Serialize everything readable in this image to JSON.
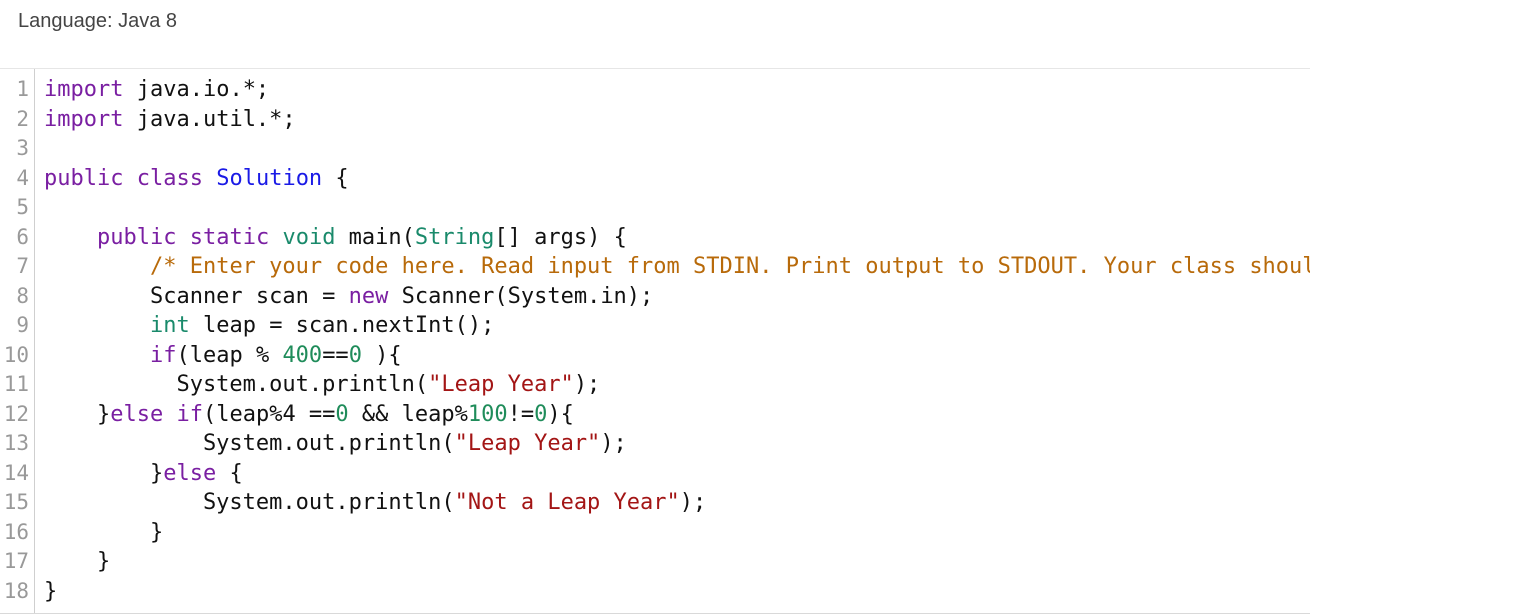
{
  "header": {
    "language_label": "Language: Java 8"
  },
  "colors": {
    "keyword": "#7a1fa2",
    "type": "#1a8a6b",
    "definition": "#1a1ae6",
    "string": "#a31515",
    "number": "#1f8c5a",
    "comment": "#b86a0a",
    "plain": "#111111",
    "line_number": "#999999"
  },
  "editor": {
    "lines": [
      {
        "n": "1",
        "tokens": [
          [
            "kw",
            "import"
          ],
          [
            "plain",
            " java.io.*;"
          ]
        ]
      },
      {
        "n": "2",
        "tokens": [
          [
            "kw",
            "import"
          ],
          [
            "plain",
            " java.util.*;"
          ]
        ]
      },
      {
        "n": "3",
        "tokens": []
      },
      {
        "n": "4",
        "tokens": [
          [
            "kw",
            "public"
          ],
          [
            "plain",
            " "
          ],
          [
            "kw",
            "class"
          ],
          [
            "plain",
            " "
          ],
          [
            "def",
            "Solution"
          ],
          [
            "plain",
            " {"
          ]
        ]
      },
      {
        "n": "5",
        "tokens": []
      },
      {
        "n": "6",
        "tokens": [
          [
            "plain",
            "    "
          ],
          [
            "kw",
            "public"
          ],
          [
            "plain",
            " "
          ],
          [
            "kw",
            "static"
          ],
          [
            "plain",
            " "
          ],
          [
            "type",
            "void"
          ],
          [
            "plain",
            " main("
          ],
          [
            "type",
            "String"
          ],
          [
            "plain",
            "[] args) {"
          ]
        ]
      },
      {
        "n": "7",
        "tokens": [
          [
            "plain",
            "        "
          ],
          [
            "com",
            "/* Enter your code here. Read input from STDIN. Print output to STDOUT. Your class should be named Solution. */"
          ]
        ]
      },
      {
        "n": "8",
        "tokens": [
          [
            "plain",
            "        Scanner scan = "
          ],
          [
            "kw",
            "new"
          ],
          [
            "plain",
            " Scanner(System.in);"
          ]
        ]
      },
      {
        "n": "9",
        "tokens": [
          [
            "plain",
            "        "
          ],
          [
            "type",
            "int"
          ],
          [
            "plain",
            " leap = scan.nextInt();"
          ]
        ]
      },
      {
        "n": "10",
        "tokens": [
          [
            "plain",
            "        "
          ],
          [
            "kw",
            "if"
          ],
          [
            "plain",
            "(leap % "
          ],
          [
            "num",
            "400"
          ],
          [
            "plain",
            "=="
          ],
          [
            "num",
            "0"
          ],
          [
            "plain",
            " ){"
          ]
        ]
      },
      {
        "n": "11",
        "tokens": [
          [
            "plain",
            "          System.out.println("
          ],
          [
            "str",
            "\"Leap Year\""
          ],
          [
            "plain",
            ");"
          ]
        ]
      },
      {
        "n": "12",
        "tokens": [
          [
            "plain",
            "    }"
          ],
          [
            "kw",
            "else"
          ],
          [
            "plain",
            " "
          ],
          [
            "kw",
            "if"
          ],
          [
            "plain",
            "(leap%4 =="
          ],
          [
            "num",
            "0"
          ],
          [
            "plain",
            " && leap%"
          ],
          [
            "num",
            "100"
          ],
          [
            "plain",
            "!="
          ],
          [
            "num",
            "0"
          ],
          [
            "plain",
            "){"
          ]
        ]
      },
      {
        "n": "13",
        "tokens": [
          [
            "plain",
            "            System.out.println("
          ],
          [
            "str",
            "\"Leap Year\""
          ],
          [
            "plain",
            ");"
          ]
        ]
      },
      {
        "n": "14",
        "tokens": [
          [
            "plain",
            "        }"
          ],
          [
            "kw",
            "else"
          ],
          [
            "plain",
            " {"
          ]
        ]
      },
      {
        "n": "15",
        "tokens": [
          [
            "plain",
            "            System.out.println("
          ],
          [
            "str",
            "\"Not a Leap Year\""
          ],
          [
            "plain",
            ");"
          ]
        ]
      },
      {
        "n": "16",
        "tokens": [
          [
            "plain",
            "        }"
          ]
        ]
      },
      {
        "n": "17",
        "tokens": [
          [
            "plain",
            "    }"
          ]
        ]
      },
      {
        "n": "18",
        "tokens": [
          [
            "plain",
            "}"
          ]
        ]
      }
    ]
  }
}
